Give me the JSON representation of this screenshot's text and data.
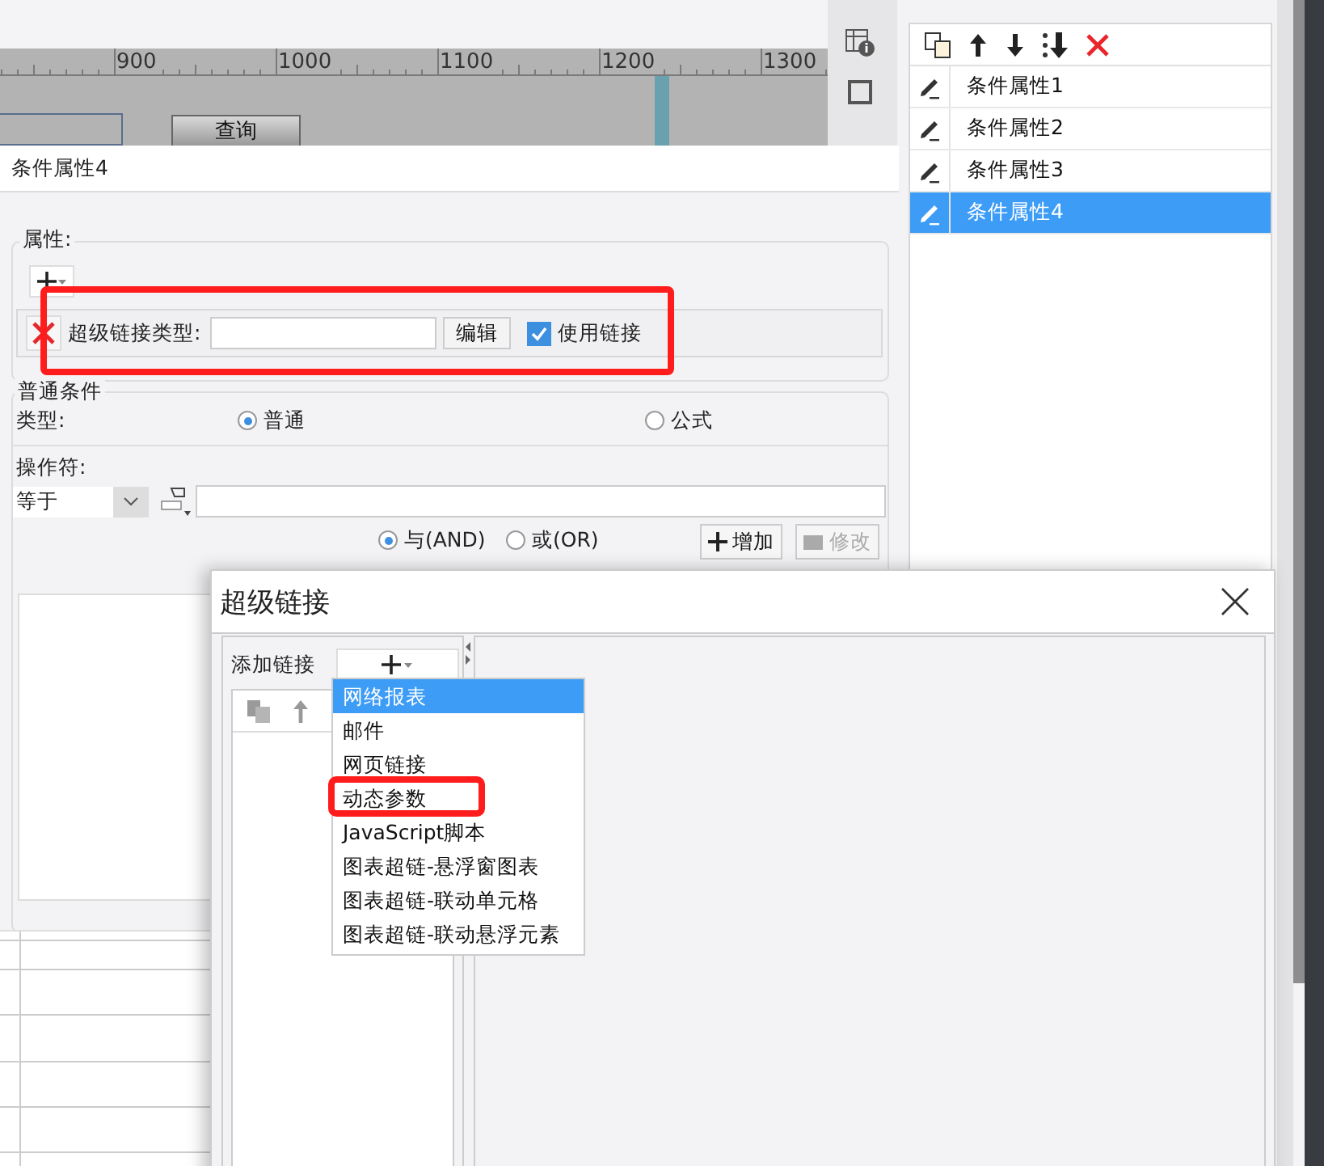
{
  "ruler": {
    "labels": [
      "900",
      "1000",
      "1100",
      "1200",
      "1300"
    ]
  },
  "canvas": {
    "query_button": "查询"
  },
  "condition_list": {
    "items": [
      {
        "label": "条件属性1",
        "selected": false
      },
      {
        "label": "条件属性2",
        "selected": false
      },
      {
        "label": "条件属性3",
        "selected": false
      },
      {
        "label": "条件属性4",
        "selected": true
      }
    ]
  },
  "condition_panel": {
    "title": "条件属性4",
    "properties_legend": "属性:",
    "hyperlink_row": {
      "label": "超级链接类型:",
      "edit_button": "编辑",
      "use_link": {
        "label": "使用链接",
        "checked": true
      }
    },
    "normal_condition": {
      "legend": "普通条件",
      "type_label": "类型:",
      "type_options": [
        {
          "label": "普通",
          "selected": true
        },
        {
          "label": "公式",
          "selected": false
        }
      ],
      "operator_label": "操作符:",
      "operator_value": "等于",
      "join_options": [
        {
          "label": "与(AND)",
          "selected": true
        },
        {
          "label": "或(OR)",
          "selected": false
        }
      ],
      "add_button": "增加",
      "modify_button": {
        "label": "修改",
        "disabled": true
      }
    }
  },
  "dialog": {
    "title": "超级链接",
    "add_link_label": "添加链接",
    "menu": [
      {
        "label": "网络报表",
        "selected": true
      },
      {
        "label": "邮件",
        "selected": false
      },
      {
        "label": "网页链接",
        "selected": false
      },
      {
        "label": "动态参数",
        "selected": false
      },
      {
        "label": "JavaScript脚本",
        "selected": false
      },
      {
        "label": "图表超链-悬浮窗图表",
        "selected": false
      },
      {
        "label": "图表超链-联动单元格",
        "selected": false
      },
      {
        "label": "图表超链-联动悬浮元素",
        "selected": false
      }
    ]
  }
}
